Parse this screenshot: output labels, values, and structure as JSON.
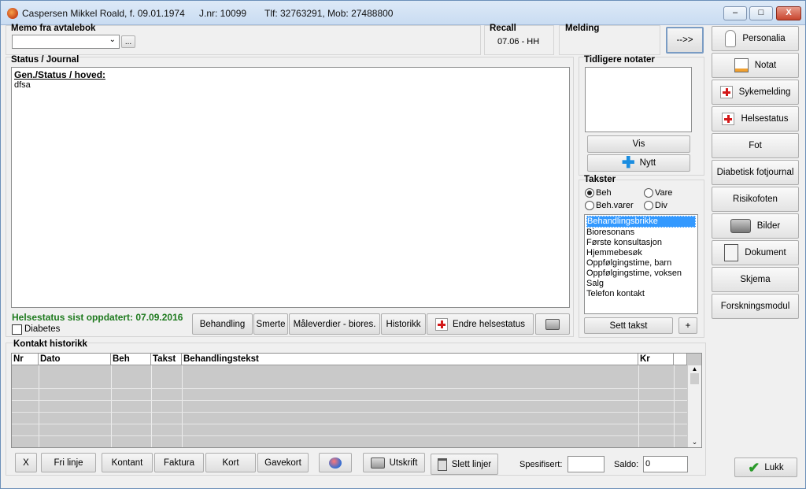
{
  "window": {
    "patient": "Caspersen Mikkel Roald, f. 09.01.1974",
    "jnr": "J.nr: 10099",
    "phones": "Tlf: 32763291,   Mob: 27488800",
    "controls": {
      "minimize": "–",
      "maximize": "□",
      "close": "X"
    }
  },
  "memo": {
    "label": "Memo fra avtalebok",
    "browse": "..."
  },
  "recall": {
    "label": "Recall",
    "value": "07.06 - HH"
  },
  "melding": {
    "label": "Melding"
  },
  "arrow_button": "-->>",
  "journal": {
    "label": "Status / Journal",
    "heading": "Gen./Status / hoved:",
    "text": "dfsa"
  },
  "health": {
    "updated": "Helsestatus sist oppdatert: 07.09.2016",
    "diabetes": "Diabetes"
  },
  "journal_toolbar": [
    "Behandling",
    "Smerte",
    "Måleverdier - biores.",
    "Historikk",
    "Endre helsestatus"
  ],
  "notes": {
    "label": "Tidligere notater",
    "vis": "Vis",
    "nytt": "Nytt"
  },
  "takster": {
    "label": "Takster",
    "radios": [
      "Beh",
      "Vare",
      "Beh.varer",
      "Div"
    ],
    "selected": "Beh",
    "items": [
      "Behandlingsbrikke",
      "Bioresonans",
      "Første konsultasjon",
      "Hjemmebesøk",
      "Oppfølgingstime, barn",
      "Oppfølgingstime, voksen",
      "Salg",
      "Telefon kontakt"
    ],
    "selected_item": "Behandlingsbrikke",
    "sett": "Sett takst",
    "plus": "+"
  },
  "sidebar": [
    "Personalia",
    "Notat",
    "Sykemelding",
    "Helsestatus",
    "Fot",
    "Diabetisk fotjournal",
    "Risikofoten",
    "Bilder",
    "Dokument",
    "Skjema",
    "Forskningsmodul"
  ],
  "history": {
    "label": "Kontakt historikk",
    "columns": [
      "Nr",
      "Dato",
      "Beh",
      "Takst",
      "Behandlingstekst",
      "Kr"
    ]
  },
  "bottom": {
    "x": "X",
    "fri": "Fri linje",
    "kontant": "Kontant",
    "faktura": "Faktura",
    "kort": "Kort",
    "gavekort": "Gavekort",
    "utskrift": "Utskrift",
    "slett": "Slett linjer",
    "spesifisert": "Spesifisert:",
    "saldo": "Saldo:",
    "saldo_value": "0"
  },
  "lukk": "Lukk",
  "colors": {
    "selection": "#3399ff",
    "health_green": "#1e7a1e"
  }
}
